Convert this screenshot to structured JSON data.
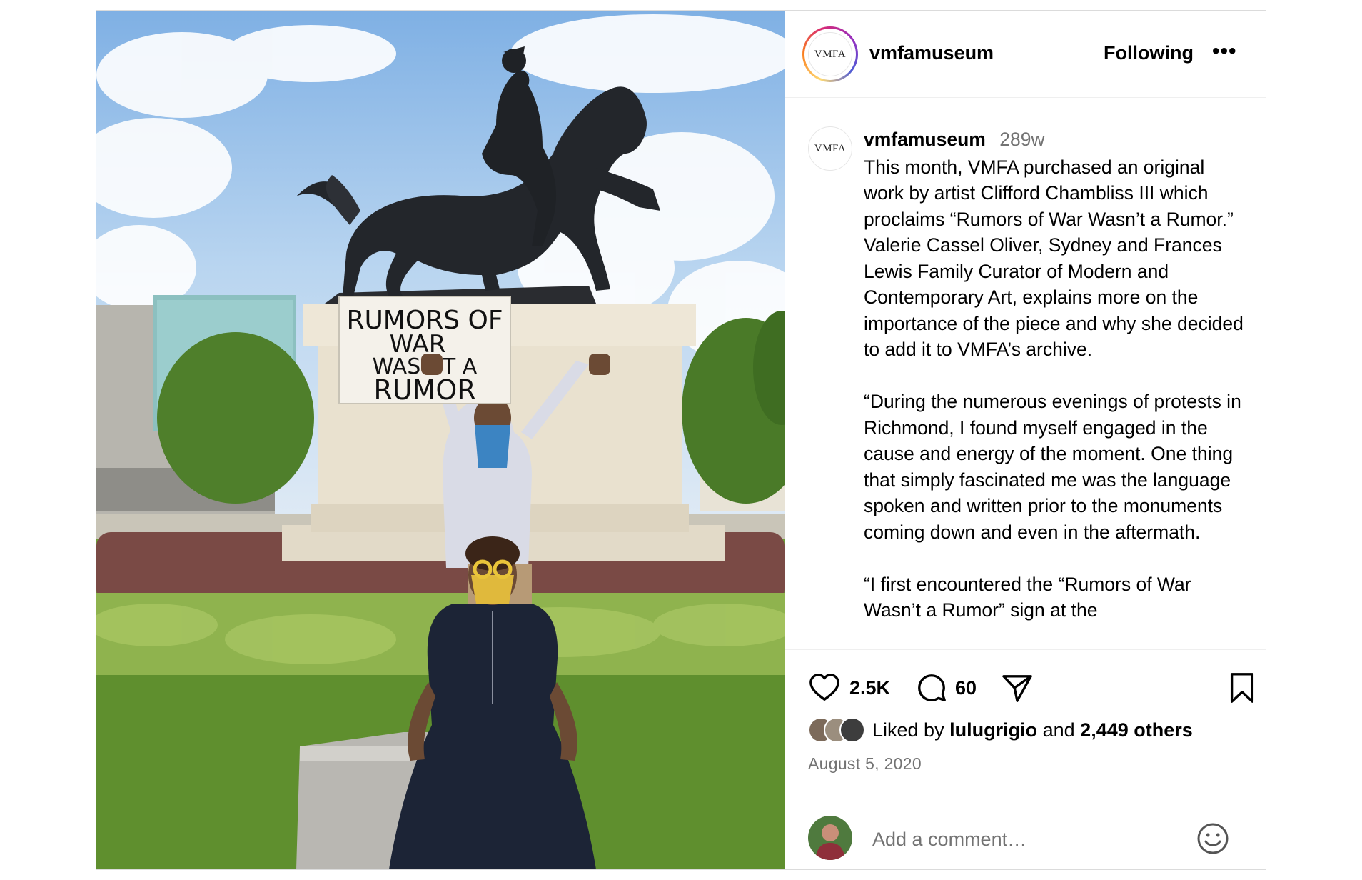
{
  "post": {
    "photo_sign_lines": [
      "RUMORS OF",
      "WAR",
      "WASN'T A",
      "RUMOR"
    ],
    "header": {
      "logo_text": "VMFA",
      "username": "vmfamuseum",
      "follow_label": "Following",
      "more_label": "•••"
    },
    "caption": {
      "avatar_text": "VMFA",
      "username": "vmfamuseum",
      "time": "289w",
      "paragraphs": [
        "This month, VMFA purchased an original work by artist Clifford Chambliss III which proclaims “Rumors of War Wasn’t a Rumor.” Valerie Cassel Oliver, Sydney and Frances Lewis Family Curator of Modern and Contemporary Art, explains more on the importance of the piece and why she decided to add it to VMFA’s archive.",
        "“During the numerous evenings of protests in Richmond, I found myself engaged in the cause and energy of the moment. One thing that simply fascinated me was the language spoken and written prior to the monuments coming down and even in the aftermath.",
        "“I first encountered the “Rumors of War Wasn’t a Rumor” sign at the"
      ]
    },
    "actions": {
      "like_count": "2.5K",
      "comment_count": "60",
      "liked_by_prefix": "Liked by",
      "liked_by_user": "lulugrigio",
      "liked_by_and": "and",
      "liked_by_others": "2,449 others",
      "date": "August 5, 2020",
      "comment_placeholder": "Add a comment…"
    }
  },
  "icons": [
    "heart-icon",
    "comment-icon",
    "share-icon",
    "bookmark-icon",
    "emoji-icon",
    "more-icon"
  ]
}
